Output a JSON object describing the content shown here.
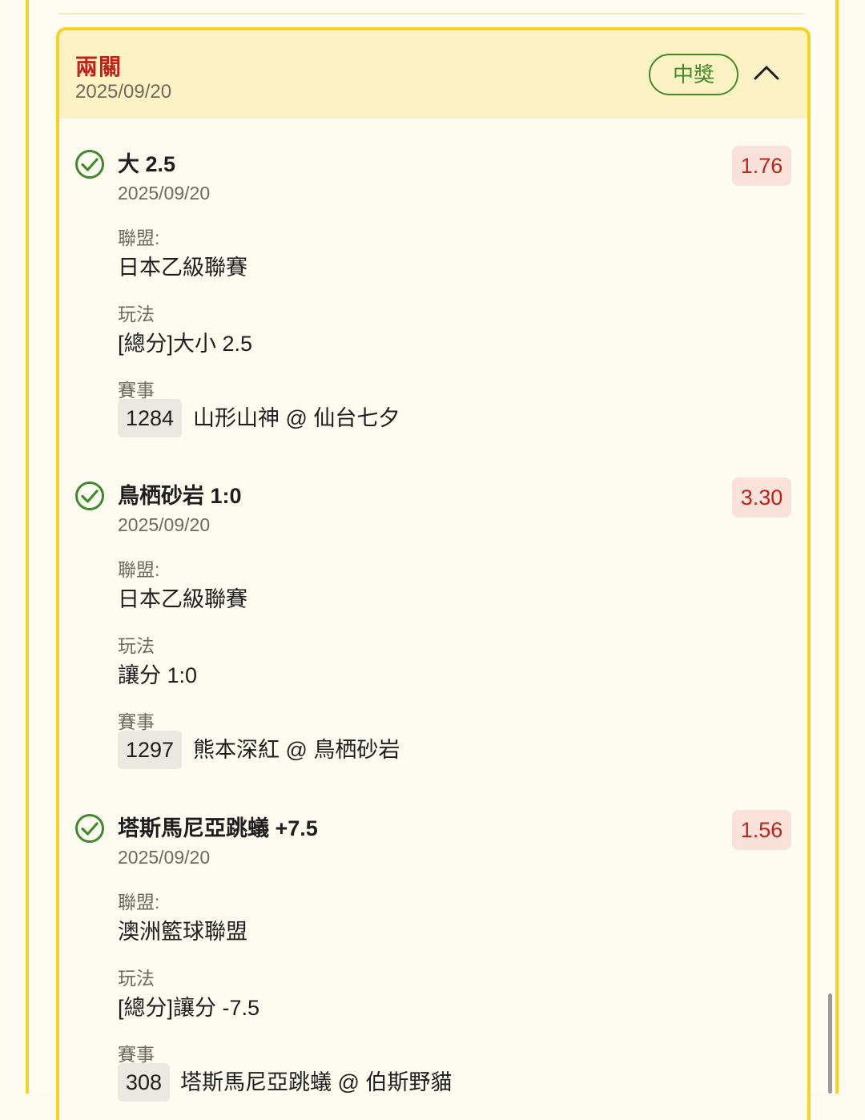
{
  "bet": {
    "type": "兩關",
    "date": "2025/09/20",
    "status": "中獎",
    "collapse_icon": "chevron-up-icon"
  },
  "colors": {
    "rail": "#f7d21e",
    "header_bg": "#fdf2c4",
    "accent_red": "#c0231b",
    "win_green": "#3f8a2c",
    "odds_bg": "#f8e2da"
  },
  "legs": [
    {
      "title": "大 2.5",
      "date": "2025/09/20",
      "odds": "1.76",
      "league_label": "聯盟:",
      "league": "日本乙級聯賽",
      "play_label": "玩法",
      "play": "[總分]大小 2.5",
      "event_label": "賽事",
      "match_id": "1284",
      "match": "山形山神 @ 仙台七夕",
      "status_icon": "check-circle-icon"
    },
    {
      "title": "鳥栖砂岩 1:0",
      "date": "2025/09/20",
      "odds": "3.30",
      "league_label": "聯盟:",
      "league": "日本乙級聯賽",
      "play_label": "玩法",
      "play": "讓分 1:0",
      "event_label": "賽事",
      "match_id": "1297",
      "match": "熊本深紅 @ 鳥栖砂岩",
      "status_icon": "check-circle-icon"
    },
    {
      "title": "塔斯馬尼亞跳蟻 +7.5",
      "date": "2025/09/20",
      "odds": "1.56",
      "league_label": "聯盟:",
      "league": "澳洲籃球聯盟",
      "play_label": "玩法",
      "play": "[總分]讓分 -7.5",
      "event_label": "賽事",
      "match_id": "308",
      "match": "塔斯馬尼亞跳蟻 @ 伯斯野貓",
      "status_icon": "check-circle-icon"
    }
  ]
}
